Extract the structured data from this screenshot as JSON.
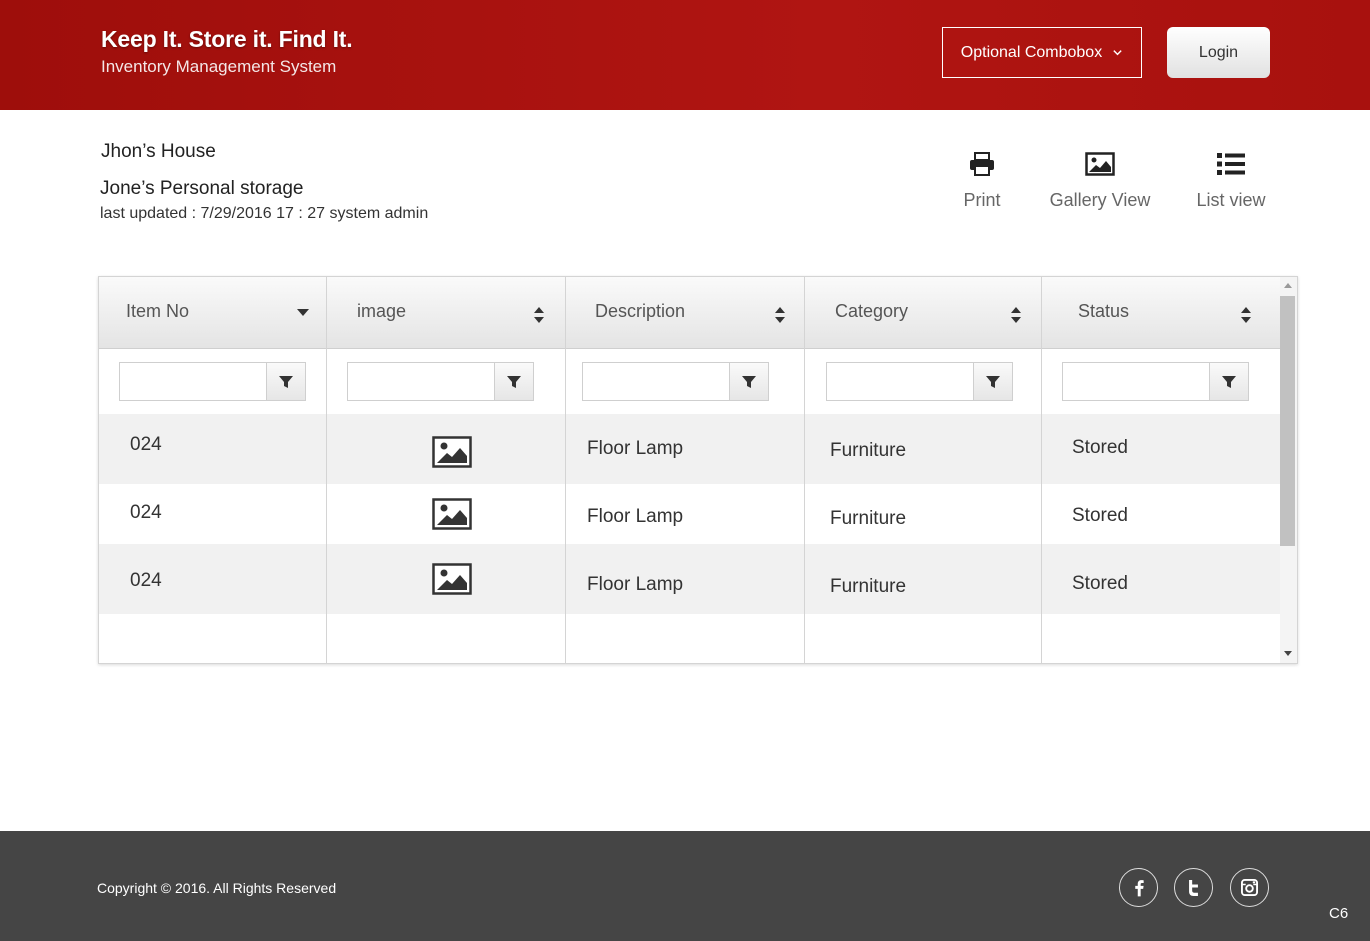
{
  "header": {
    "brand_title": "Keep It. Store it. Find It.",
    "brand_subtitle": "Inventory Management System",
    "combobox_label": "Optional Combobox",
    "login_label": "Login"
  },
  "info": {
    "house": "Jhon’s House",
    "storage": "Jone’s Personal storage",
    "last_updated": "last updated : 7/29/2016 17 : 27 system admin"
  },
  "toolbar": {
    "print": "Print",
    "gallery_view": "Gallery View",
    "list_view": "List view"
  },
  "table": {
    "columns": [
      "Item No",
      "image",
      "Description",
      "Category",
      "Status"
    ],
    "rows": [
      {
        "item_no": "024",
        "image": "image-icon",
        "description": "Floor Lamp",
        "category": "Furniture",
        "status": "Stored"
      },
      {
        "item_no": "024",
        "image": "image-icon",
        "description": "Floor Lamp",
        "category": "Furniture",
        "status": "Stored"
      },
      {
        "item_no": "024",
        "image": "image-icon",
        "description": "Floor Lamp",
        "category": "Furniture",
        "status": "Stored"
      }
    ]
  },
  "footer": {
    "copyright": "Copyright © 2016. All Rights Reserved",
    "social": [
      "facebook-icon",
      "twitter-icon",
      "instagram-icon"
    ],
    "code": "C6"
  },
  "colors": {
    "header_red": "#a8110e",
    "footer_gray": "#454545",
    "row_alt": "#f1f1f1"
  }
}
